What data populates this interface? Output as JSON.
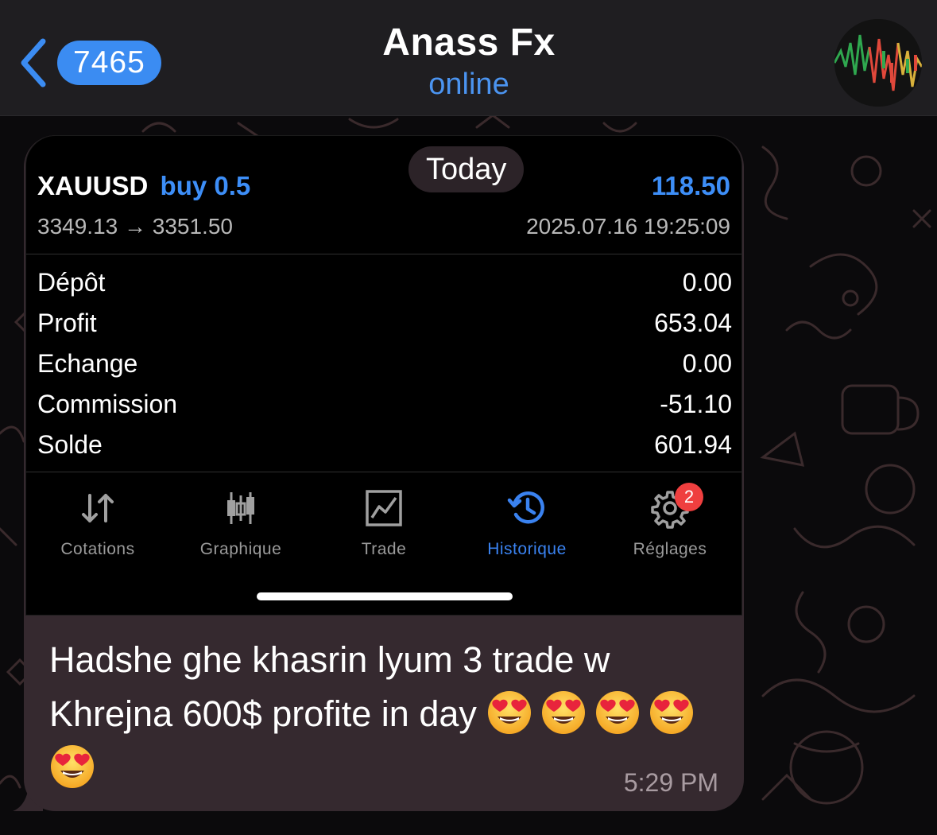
{
  "header": {
    "back_badge": "7465",
    "title": "Anass Fx",
    "status": "online",
    "status_color": "#4b94f0"
  },
  "message": {
    "date_pill": "Today",
    "screenshot": {
      "symbol": "XAUUSD",
      "direction": "buy 0.5",
      "trade_profit": "118.50",
      "prices": "3349.13 → 3351.50",
      "datetime": "2025.07.16 19:25:09",
      "summary": [
        {
          "label": "Dépôt",
          "value": "0.00"
        },
        {
          "label": "Profit",
          "value": "653.04"
        },
        {
          "label": "Echange",
          "value": "0.00"
        },
        {
          "label": "Commission",
          "value": "-51.10"
        },
        {
          "label": "Solde",
          "value": "601.94"
        }
      ],
      "tabs": [
        {
          "label": "Cotations",
          "icon": "arrows-updown-icon",
          "active": false
        },
        {
          "label": "Graphique",
          "icon": "candlestick-icon",
          "active": false
        },
        {
          "label": "Trade",
          "icon": "trade-chart-icon",
          "active": false
        },
        {
          "label": "Historique",
          "icon": "history-icon",
          "active": true
        },
        {
          "label": "Réglages",
          "icon": "gear-icon",
          "active": false,
          "badge": "2"
        }
      ],
      "accent_color": "#3d8ef7"
    },
    "text": "Hadshe ghe khasrin lyum 3 trade w Khrejna 600$ profite in day",
    "emojis": [
      "heart-eyes-emoji",
      "heart-eyes-emoji",
      "heart-eyes-emoji",
      "heart-eyes-emoji",
      "heart-eyes-emoji"
    ],
    "time": "5:29 PM",
    "bubble_color": "#35292f"
  }
}
